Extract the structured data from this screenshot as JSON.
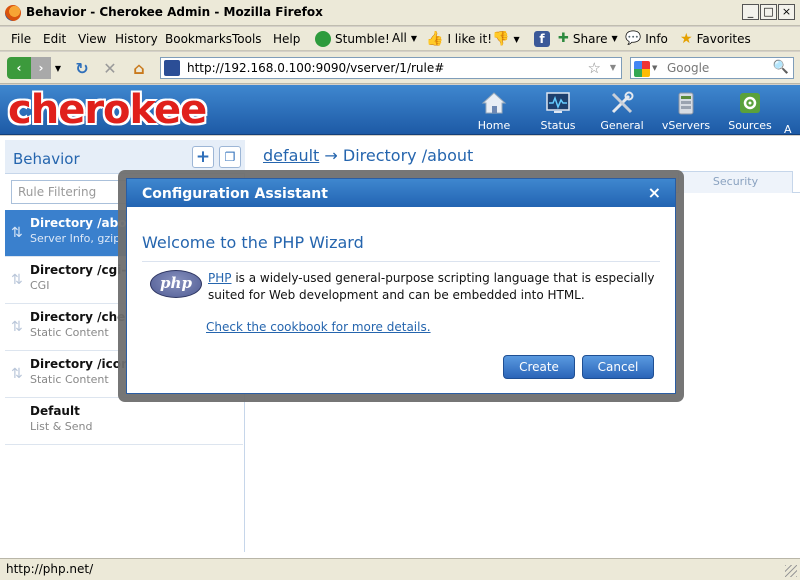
{
  "window": {
    "title": "Behavior - Cherokee Admin - Mozilla Firefox",
    "buttons": [
      "_",
      "□",
      "×"
    ]
  },
  "menu": {
    "items": [
      "File",
      "Edit",
      "View",
      "History",
      "Bookmarks",
      "Tools",
      "Help"
    ],
    "toolbar": {
      "stumble": "Stumble!",
      "all": "All",
      "like": "I like it!",
      "share": "Share",
      "info": "Info",
      "favorites": "Favorites"
    }
  },
  "nav": {
    "url": "http://192.168.0.100:9090/vserver/1/rule#",
    "search_placeholder": "Google"
  },
  "header": {
    "logo": "cherokee",
    "items": [
      "Home",
      "Status",
      "General",
      "vServers",
      "Sources",
      "A"
    ]
  },
  "sidebar": {
    "title": "Behavior",
    "filter_placeholder": "Rule Filtering",
    "rules": [
      {
        "title": "Directory /about",
        "subtitle": "Server Info, gzip"
      },
      {
        "title": "Directory /cgi-bin",
        "subtitle": "CGI"
      },
      {
        "title": "Directory /cherokee_themes",
        "subtitle": "Static Content"
      },
      {
        "title": "Directory /icons",
        "subtitle": "Static Content"
      },
      {
        "title": "Default",
        "subtitle": "List & Send"
      }
    ]
  },
  "main": {
    "title_link": "default",
    "title_rest": "→ Directory /about",
    "tab_security": "Security"
  },
  "dialog": {
    "title": "Configuration Assistant",
    "close": "×",
    "heading": "Welcome to the PHP Wizard",
    "logo_text": "php",
    "desc_link": "PHP",
    "desc_text": " is a widely-used general-purpose scripting language that is especially suited for Web development and can be embedded into HTML.",
    "cookbook_link": "Check the cookbook for more details.",
    "create_label": "Create",
    "cancel_label": "Cancel"
  },
  "status": {
    "text": "http://php.net/"
  },
  "colors": {
    "brand_blue": "#2565ae",
    "logo_red": "#e0201b",
    "active_rule": "#3a80cd"
  }
}
